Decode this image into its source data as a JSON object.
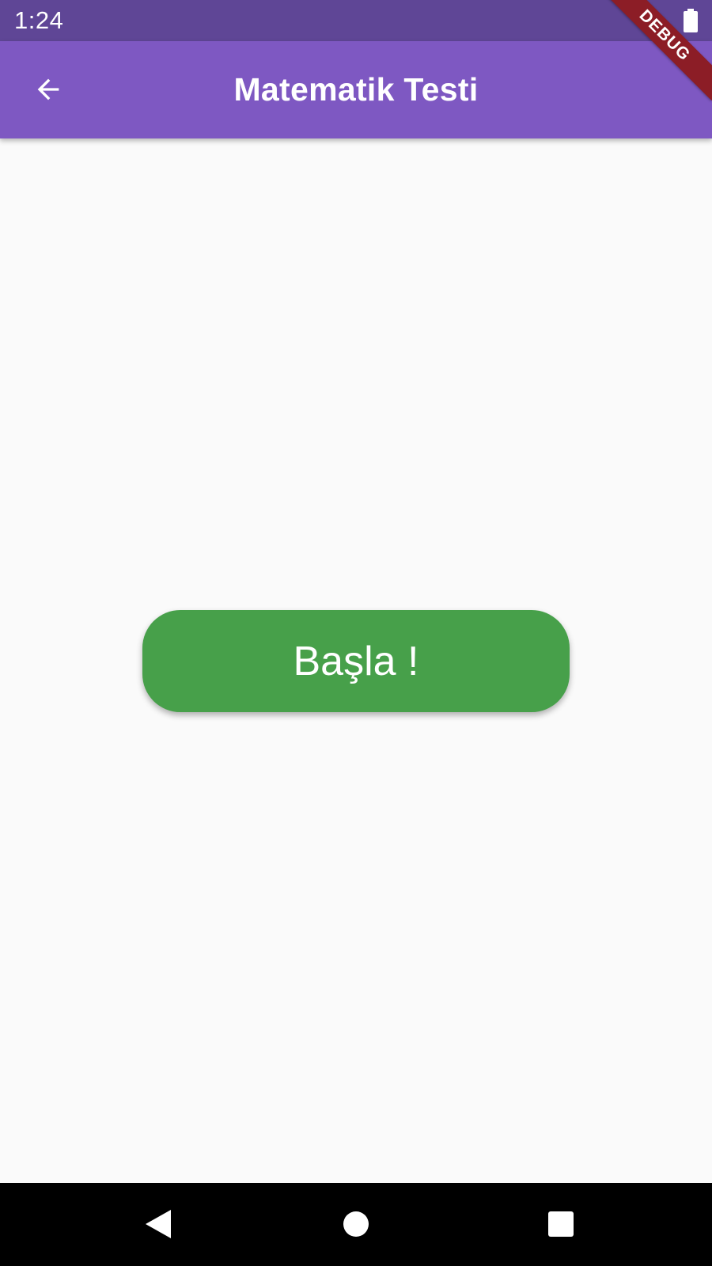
{
  "status_bar": {
    "time": "1:24",
    "battery_icon": "battery-full-icon"
  },
  "debug_banner": {
    "label": "DEBUG",
    "color": "#8c1d26"
  },
  "app_bar": {
    "title": "Matematik Testi",
    "back_icon": "arrow-back-icon",
    "color": "#7e58c2"
  },
  "main": {
    "start_button_label": "Başla !",
    "start_button_color": "#47a04a"
  },
  "nav_bar": {
    "back_icon": "triangle-back-icon",
    "home_icon": "circle-home-icon",
    "recents_icon": "square-recents-icon"
  }
}
